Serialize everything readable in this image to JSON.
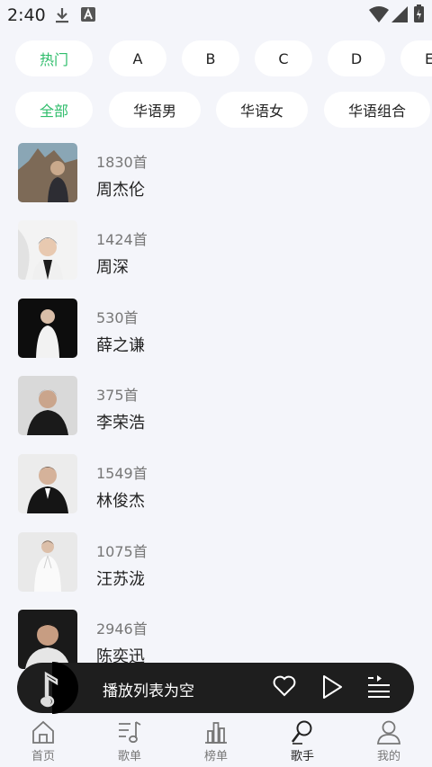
{
  "status_bar": {
    "time": "2:40"
  },
  "letter_chips": [
    "热门",
    "A",
    "B",
    "C",
    "D",
    "E"
  ],
  "category_chips": [
    "全部",
    "华语男",
    "华语女",
    "华语组合"
  ],
  "singers": [
    {
      "count": "1830首",
      "name": "周杰伦"
    },
    {
      "count": "1424首",
      "name": "周深"
    },
    {
      "count": "530首",
      "name": "薛之谦"
    },
    {
      "count": "375首",
      "name": "李荣浩"
    },
    {
      "count": "1549首",
      "name": "林俊杰"
    },
    {
      "count": "1075首",
      "name": "汪苏泷"
    },
    {
      "count": "2946首",
      "name": "陈奕迅"
    }
  ],
  "player": {
    "label": "播放列表为空"
  },
  "tabs": [
    "首页",
    "歌单",
    "榜单",
    "歌手",
    "我的"
  ],
  "colors": {
    "accent": "#2fbd6b",
    "player_bg": "#1e1e1e",
    "page_bg": "#f4f5fa"
  }
}
